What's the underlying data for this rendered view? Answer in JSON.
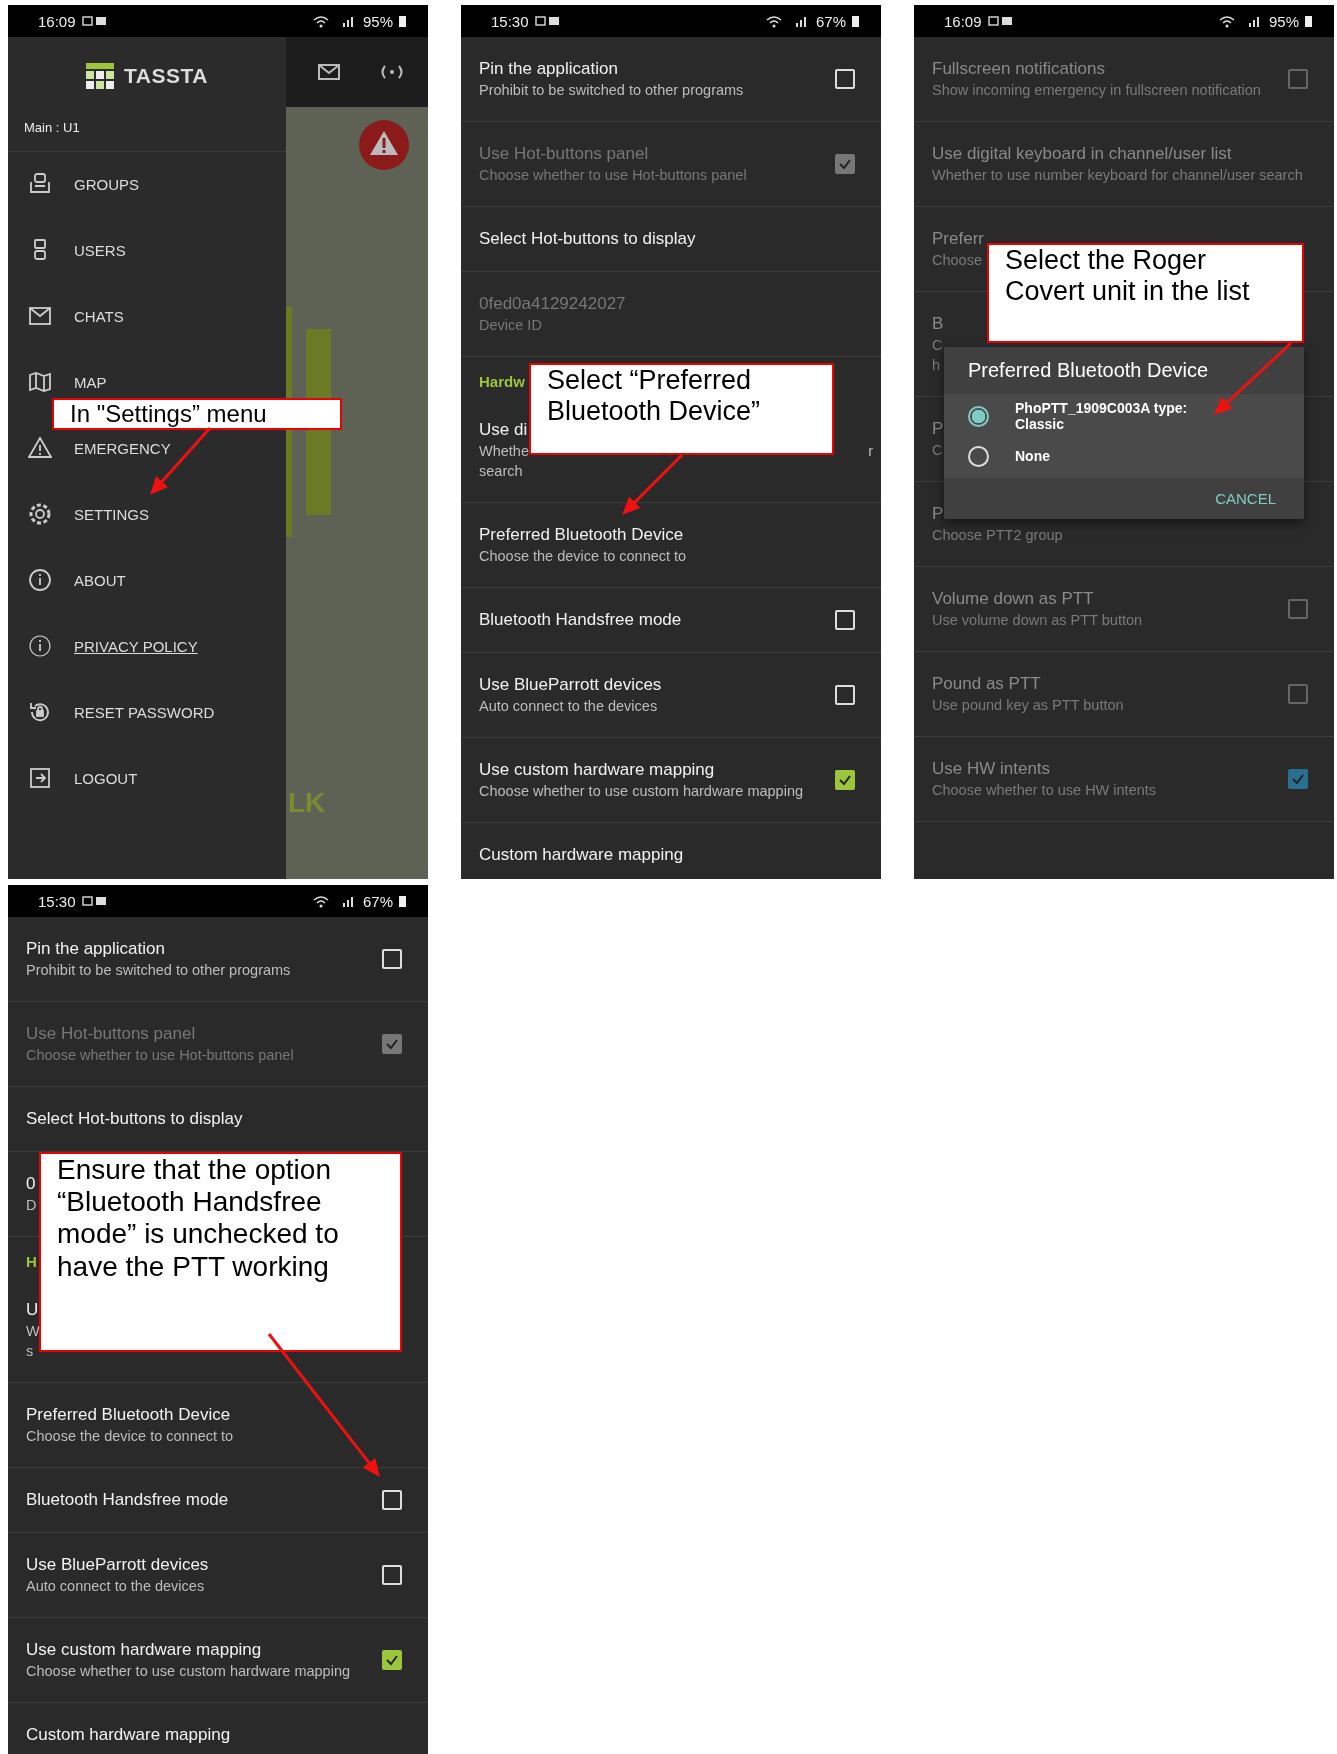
{
  "phones": [
    {
      "kind": "drawer",
      "status": {
        "time": "16:09",
        "battery": "95%"
      },
      "brand": "TASSTA",
      "account": "Main : U1",
      "menu": [
        {
          "label": "GROUPS",
          "link": false
        },
        {
          "label": "USERS",
          "link": false
        },
        {
          "label": "CHATS",
          "link": false
        },
        {
          "label": "MAP",
          "link": false
        },
        {
          "label": "EMERGENCY",
          "link": false
        },
        {
          "label": "SETTINGS",
          "link": false
        },
        {
          "label": "ABOUT",
          "link": false
        },
        {
          "label": "PRIVACY POLICY",
          "link": true
        },
        {
          "label": "RESET PASSWORD",
          "link": false
        },
        {
          "label": "LOGOUT",
          "link": false
        }
      ],
      "background_text": "LK",
      "callout": "In \"Settings” menu"
    },
    {
      "kind": "settings",
      "status": {
        "time": "15:30",
        "battery": "67%"
      },
      "items": [
        {
          "kind": "option",
          "title": "Pin the application",
          "subtitle": "Prohibit to be switched to other programs",
          "checked": false,
          "disabled": false
        },
        {
          "kind": "option",
          "title": "Use Hot-buttons panel",
          "subtitle": "Choose whether to use Hot-buttons panel",
          "checked": true,
          "disabled": true
        },
        {
          "kind": "option",
          "title": "Select Hot-buttons to display",
          "disabled": false
        },
        {
          "kind": "option",
          "title": "0fed0a4129242027",
          "subtitle": "Device ID",
          "disabled": true
        },
        {
          "kind": "header",
          "title": "Hardw"
        },
        {
          "kind": "covered",
          "title": "Use di",
          "lines": [
            "Whethe",
            "search"
          ],
          "tail": "r"
        },
        {
          "kind": "option",
          "title": "Preferred Bluetooth Device",
          "subtitle": "Choose the device to connect to",
          "disabled": false
        },
        {
          "kind": "option",
          "title": "Bluetooth Handsfree mode",
          "checked": false,
          "disabled": false
        },
        {
          "kind": "option",
          "title": "Use BlueParrott devices",
          "subtitle": "Auto connect to the devices",
          "checked": false,
          "disabled": false
        },
        {
          "kind": "option",
          "title": "Use custom hardware mapping",
          "subtitle": "Choose whether to use custom hardware mapping",
          "checked": true,
          "disabled": false
        },
        {
          "kind": "option",
          "title": "Custom hardware mapping",
          "disabled": false
        }
      ],
      "callout": "Select “Preferred Bluetooth Device”"
    },
    {
      "kind": "settings",
      "status": {
        "time": "16:09",
        "battery": "95%"
      },
      "items": [
        {
          "kind": "option",
          "title": "Fullscreen notifications",
          "subtitle": "Show incoming emergency in fullscreen notification",
          "checked": false,
          "disabled": false
        },
        {
          "kind": "option",
          "title": "Use digital keyboard in channel/user list",
          "subtitle": "Whether to use number keyboard for channel/user search",
          "disabled": false
        },
        {
          "kind": "covered",
          "title": "Preferr",
          "lines": [
            "Choose"
          ]
        },
        {
          "kind": "covered",
          "title": "B",
          "lines": [
            "C",
            "h"
          ]
        },
        {
          "kind": "covered",
          "title": "P",
          "lines": [
            "C"
          ]
        },
        {
          "kind": "covered",
          "title": "P",
          "lines": [
            "Choose PTT2 group"
          ]
        },
        {
          "kind": "option",
          "title": "Volume down as PTT",
          "subtitle": "Use volume down as PTT button",
          "checked": false,
          "disabled": false
        },
        {
          "kind": "option",
          "title": "Pound as PTT",
          "subtitle": "Use pound key as PTT button",
          "checked": false,
          "disabled": false
        },
        {
          "kind": "option",
          "title": "Use HW intents",
          "subtitle": "Choose whether to use HW intents",
          "checked": true,
          "disabled": false
        }
      ],
      "dialog": {
        "title": "Preferred Bluetooth Device",
        "options": [
          {
            "label": "PhoPTT_1909C003A type: Classic",
            "selected": true
          },
          {
            "label": "None",
            "selected": false
          }
        ],
        "cancel": "CANCEL"
      },
      "callout": "Select the Roger Covert unit in the list"
    },
    {
      "kind": "settings",
      "status": {
        "time": "15:30",
        "battery": "67%"
      },
      "items": [
        {
          "kind": "option",
          "title": "Pin the application",
          "subtitle": "Prohibit to be switched to other programs",
          "checked": false,
          "disabled": false
        },
        {
          "kind": "option",
          "title": "Use Hot-buttons panel",
          "subtitle": "Choose whether to use Hot-buttons panel",
          "checked": true,
          "disabled": true
        },
        {
          "kind": "option",
          "title": "Select Hot-buttons to display",
          "disabled": false
        },
        {
          "kind": "covered",
          "title": "0",
          "lines": [
            "D"
          ]
        },
        {
          "kind": "header",
          "title": "H"
        },
        {
          "kind": "covered",
          "title": "U",
          "lines": [
            "W",
            "s"
          ]
        },
        {
          "kind": "option",
          "title": "Preferred Bluetooth Device",
          "subtitle": "Choose the device to connect to",
          "disabled": false
        },
        {
          "kind": "option",
          "title": "Bluetooth Handsfree mode",
          "checked": false,
          "disabled": false
        },
        {
          "kind": "option",
          "title": "Use BlueParrott devices",
          "subtitle": "Auto connect to the devices",
          "checked": false,
          "disabled": false
        },
        {
          "kind": "option",
          "title": "Use custom hardware mapping",
          "subtitle": "Choose whether to use custom hardware mapping",
          "checked": true,
          "disabled": false
        },
        {
          "kind": "option",
          "title": "Custom hardware mapping",
          "disabled": false
        }
      ],
      "callout": "Ensure that the option “Bluetooth Handsfree mode” is unchecked to have the PTT working"
    }
  ]
}
